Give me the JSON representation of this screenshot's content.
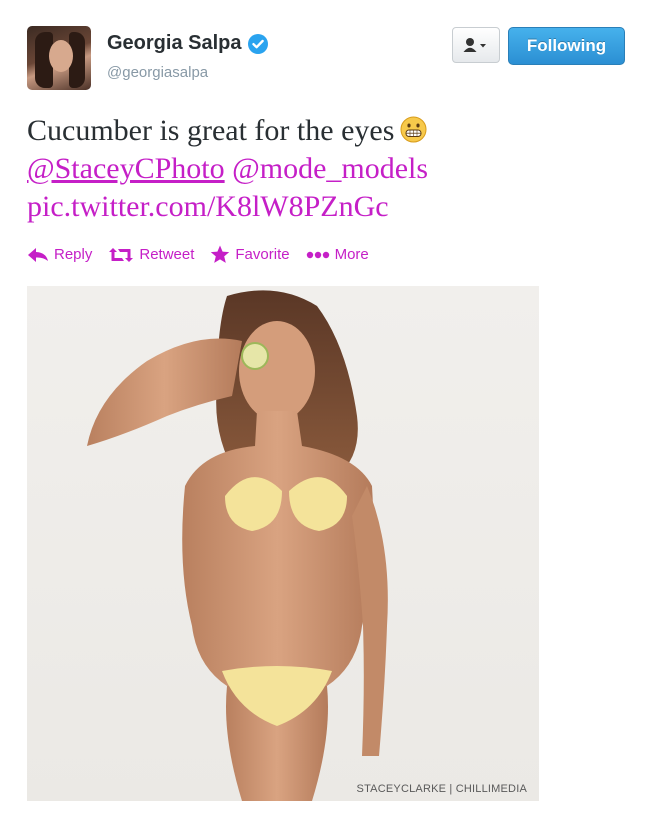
{
  "user": {
    "full_name": "Georgia Salpa",
    "handle": "@georgiasalpa",
    "verified": true
  },
  "buttons": {
    "user_menu_icon": "person-icon",
    "following_label": "Following"
  },
  "tweet": {
    "text": "Cucumber is great for the eyes",
    "emoji": "grinning-face-emoji",
    "mention_1": "@StaceyCPhoto",
    "mention_2": "@mode_models",
    "pic_link": "pic.twitter.com/K8lW8PZnGc"
  },
  "actions": {
    "reply": "Reply",
    "retweet": "Retweet",
    "favorite": "Favorite",
    "more": "More"
  },
  "photo": {
    "credit": "STACEYCLARKE | CHILLIMEDIA"
  },
  "colors": {
    "link": "#c51fc7",
    "following_button": "#2b8fd3",
    "verified_badge": "#2aa3ef"
  }
}
